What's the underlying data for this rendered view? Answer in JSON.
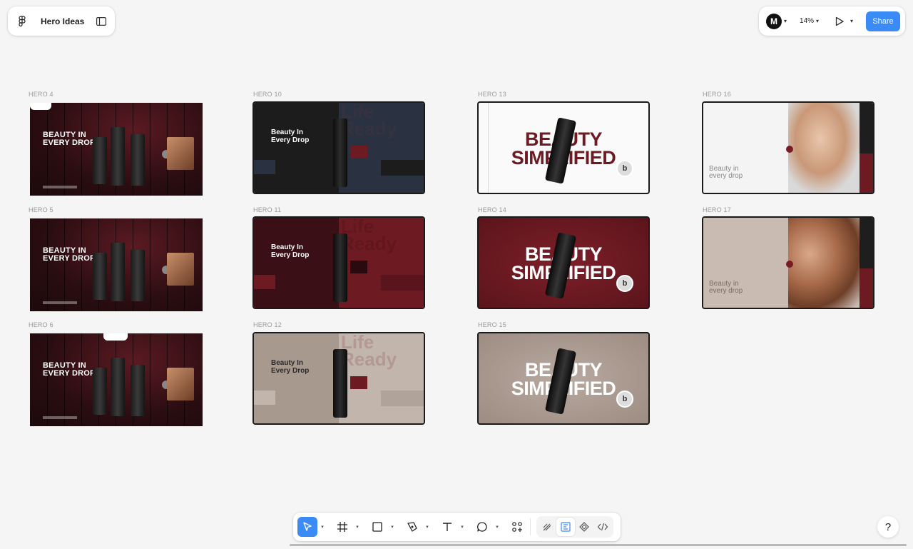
{
  "file": {
    "title": "Hero Ideas"
  },
  "header": {
    "zoom": "14%",
    "share_label": "Share",
    "avatar_initial": "M"
  },
  "frames": [
    {
      "label": "HERO 4",
      "type": "maroon",
      "heading_line1": "BEAUTY IN",
      "heading_line2": "EVERY DROP"
    },
    {
      "label": "HERO 5",
      "type": "maroon",
      "heading_line1": "BEAUTY IN",
      "heading_line2": "EVERY DROP"
    },
    {
      "label": "HERO 6",
      "type": "maroon",
      "heading_line1": "BEAUTY IN",
      "heading_line2": "EVERY DROP"
    },
    {
      "label": "HERO 10",
      "type": "split-dark",
      "heading_line1": "Beauty In",
      "heading_line2": "Every Drop",
      "ghost_line1": "Life",
      "ghost_line2": "Ready"
    },
    {
      "label": "HERO 11",
      "type": "split-maroon",
      "heading_line1": "Beauty In",
      "heading_line2": "Every Drop",
      "ghost_line1": "Life",
      "ghost_line2": "Ready"
    },
    {
      "label": "HERO 12",
      "type": "split-taupe",
      "heading_line1": "Beauty In",
      "heading_line2": "Every Drop",
      "ghost_line1": "Life",
      "ghost_line2": "Ready"
    },
    {
      "label": "HERO 13",
      "type": "simplified-white",
      "line1": "BEAUTY",
      "line2": "SIMPLIFIED",
      "badge": "b"
    },
    {
      "label": "HERO 14",
      "type": "simplified-maroon",
      "line1": "BEAUTY",
      "line2": "SIMPLIFIED",
      "badge": "b"
    },
    {
      "label": "HERO 15",
      "type": "simplified-taupe",
      "line1": "BEAUTY",
      "line2": "SIMPLIFIED",
      "badge": "b"
    },
    {
      "label": "HERO 16",
      "type": "model-white",
      "heading_line1": "Beauty in",
      "heading_line2": "every drop"
    },
    {
      "label": "HERO 17",
      "type": "model-taupe",
      "heading_line1": "Beauty in",
      "heading_line2": "every drop"
    }
  ],
  "toolbar": {
    "tools": [
      "move-tool",
      "frame-tool",
      "shape-tool",
      "pen-tool",
      "text-tool",
      "comment-tool",
      "actions-tool"
    ],
    "dev_tools": [
      "draw-mode",
      "design-mode",
      "prototype-mode",
      "dev-mode"
    ]
  },
  "help_label": "?",
  "colors": {
    "accent": "#3b8bf7",
    "canvas": "#f5f5f5",
    "maroon": "#6e1a22",
    "taupe": "#b2a39a"
  }
}
